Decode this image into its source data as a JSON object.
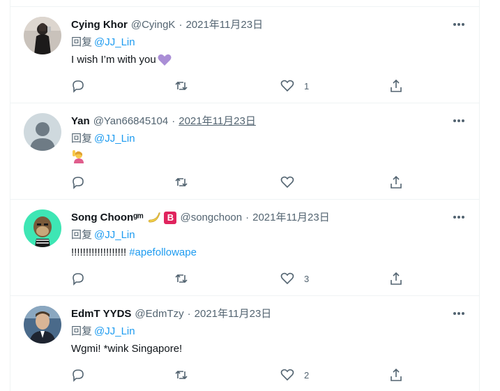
{
  "tweets": [
    {
      "name": "Cying Khor",
      "handle": "@CyingK",
      "separator": "·",
      "date": "2021年11月23日",
      "reply_prefix": "回复",
      "reply_mention": "@JJ_Lin",
      "text": "I wish I’m with you",
      "text_emoji": "purple-heart",
      "hashtag": "",
      "like_count": "1",
      "avatar": "photo-person-dark-clothes"
    },
    {
      "name": "Yan",
      "handle": "@Yan66845104",
      "separator": "·",
      "date": "2021年11月23日",
      "reply_prefix": "回复",
      "reply_mention": "@JJ_Lin",
      "text": "",
      "text_emoji": "person-raising-hand",
      "hashtag": "",
      "like_count": "",
      "avatar": "default-profile"
    },
    {
      "name": "Song Choonᵍᵐ",
      "handle": "@songchoon",
      "separator": "·",
      "date": "2021年11月23日",
      "reply_prefix": "回复",
      "reply_mention": "@JJ_Lin",
      "text": "!!!!!!!!!!!!!!!!!!!",
      "text_emoji": "",
      "hashtag": "#apefollowape",
      "like_count": "3",
      "avatar": "ape-nft",
      "name_badges": [
        "banana-emoji",
        "b-button-emoji"
      ]
    },
    {
      "name": "EdmT YYDS",
      "handle": "@EdmTzy",
      "separator": "·",
      "date": "2021年11月23日",
      "reply_prefix": "回复",
      "reply_mention": "@JJ_Lin",
      "text": "Wgmi! *wink Singapore!",
      "text_emoji": "",
      "hashtag": "",
      "like_count": "2",
      "avatar": "photo-man-in-suit"
    }
  ],
  "badges": {
    "b_button": "B"
  },
  "colors": {
    "link": "#1d9bf0",
    "secondary": "#536471",
    "border": "#eff3f4",
    "text": "#0f1419"
  }
}
